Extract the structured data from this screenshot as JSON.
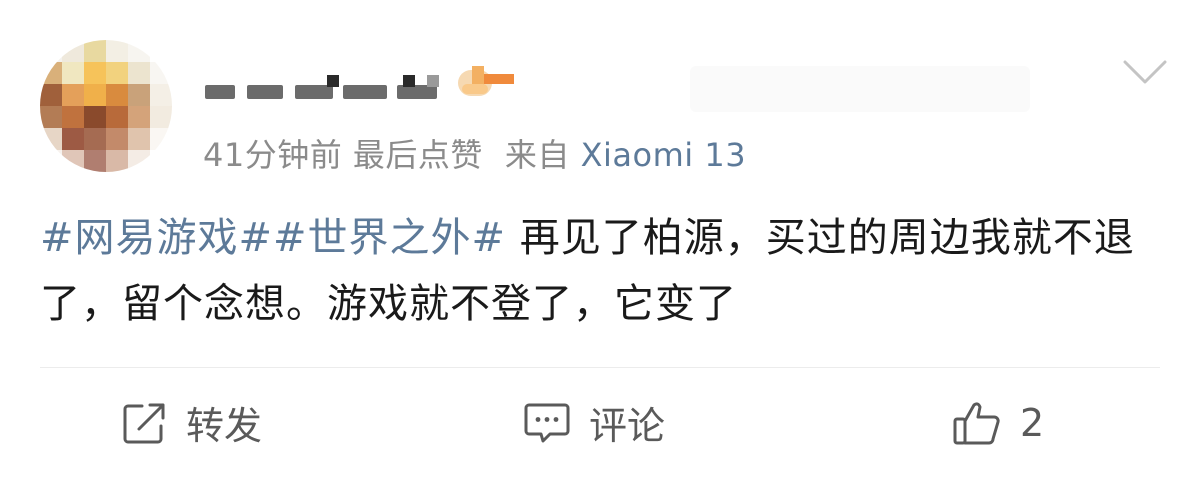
{
  "post": {
    "meta": {
      "time": "41分钟前",
      "liked_note": "最后点赞",
      "source_prefix": "来自",
      "device": "Xiaomi 13"
    },
    "content": {
      "topic1": "#网易游戏#",
      "topic2": "#世界之外#",
      "text": " 再见了柏源，买过的周边我就不退了，留个念想。游戏就不登了，它变了"
    },
    "actions": {
      "repost_label": "转发",
      "comment_label": "评论",
      "like_count": "2"
    },
    "icons": {
      "repost": "share-box-icon",
      "comment": "comment-bubble-icon",
      "like": "thumbs-up-icon",
      "more": "chevron-down-icon",
      "badge": "badge-icon"
    },
    "colors": {
      "link": "#5d7a99",
      "meta": "#8b8b8b",
      "text": "#1a1a1a",
      "action": "#5a5a5a"
    }
  }
}
